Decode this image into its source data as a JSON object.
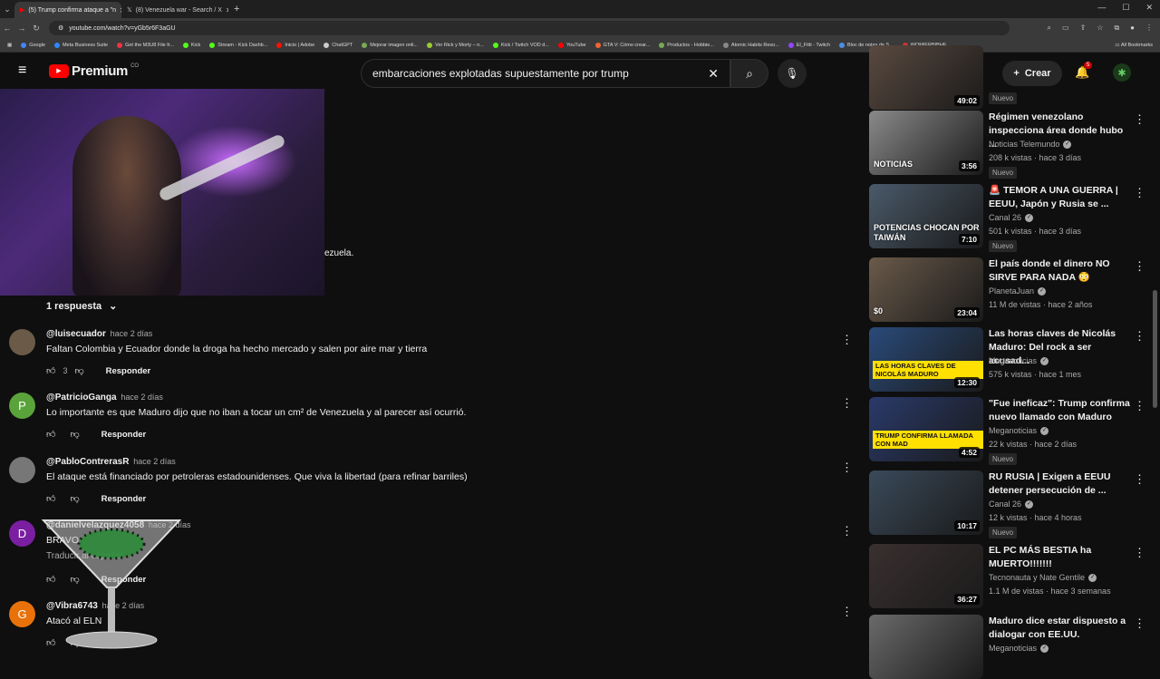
{
  "browser": {
    "tabs": [
      {
        "title": "(5) Trump confirma ataque a \"n",
        "active": true
      },
      {
        "title": "(8) Venezuela war - Search / X",
        "active": false
      }
    ],
    "url": "youtube.com/watch?v=yGb5r6F3aGU",
    "bookmarks": [
      {
        "label": "Google",
        "color": "#4285f4"
      },
      {
        "label": "Meta Business Suite",
        "color": "#2d88ff"
      },
      {
        "label": "Get the M3U8 File fr...",
        "color": "#e34"
      },
      {
        "label": "Kick",
        "color": "#53fc18"
      },
      {
        "label": "Stream - Kick Dashb...",
        "color": "#53fc18"
      },
      {
        "label": "Inicio | Adobe",
        "color": "#fa0f00"
      },
      {
        "label": "ChatGPT",
        "color": "#ccc"
      },
      {
        "label": "Mejorar imagen onli...",
        "color": "#7a5"
      },
      {
        "label": "Ver Rick y Morty – n...",
        "color": "#9c3"
      },
      {
        "label": "Kick / Twitch VOD d...",
        "color": "#53fc18"
      },
      {
        "label": "YouTube",
        "color": "#ff0000"
      },
      {
        "label": "GTA V: Cómo crear...",
        "color": "#e63"
      },
      {
        "label": "Productos - Hobbie...",
        "color": "#7a5"
      },
      {
        "label": "Atomic Habits Reso...",
        "color": "#888"
      },
      {
        "label": "El_Fitti - Twitch",
        "color": "#9146ff"
      },
      {
        "label": "Bloc de notas de S...",
        "color": "#4a90e2"
      },
      {
        "label": "WOMIERBIBHE",
        "color": "#c33"
      }
    ],
    "all_bookmarks": "All Bookmarks"
  },
  "header": {
    "logo_word": "Premium",
    "country": "CO",
    "search_value": "embarcaciones explotadas supuestamente por trump",
    "create_label": "Crear",
    "notif_count": "5"
  },
  "video": {
    "partial_text": "ezuela."
  },
  "replies_label": "1 respuesta",
  "comments": [
    {
      "user": "@luisecuador",
      "time": "hace 2 días",
      "text": "Faltan Colombia y Ecuador donde la droga ha hecho mercado y salen por aire mar y tierra",
      "likes": "3",
      "reply": "Responder",
      "avatar_letter": "",
      "avatar_color": "#6b5a48"
    },
    {
      "user": "@PatricioGanga",
      "time": "hace 2 días",
      "text": "Lo importante es que Maduro dijo que no iban a tocar un cm²  de Venezuela y al parecer así ocurrió.",
      "likes": "",
      "reply": "Responder",
      "avatar_letter": "P",
      "avatar_color": "#5aa33a"
    },
    {
      "user": "@PabloContrerasR",
      "time": "hace 2 días",
      "text": "El ataque está financiado por petroleras estadounidenses. Que viva la libertad (para refinar barriles)",
      "likes": "",
      "reply": "Responder",
      "avatar_letter": "",
      "avatar_color": "#777"
    },
    {
      "user": "@danielvelazquez4058",
      "time": "hace 2 días",
      "text": "BRAVO",
      "translate": "Traducir al español",
      "likes": "",
      "reply": "Responder",
      "avatar_letter": "D",
      "avatar_color": "#7b1fa2"
    },
    {
      "user": "@Vibra6743",
      "time": "hace 2 días",
      "text": "Atacó al ELN",
      "likes": "",
      "reply": "Responder",
      "avatar_letter": "G",
      "avatar_color": "#e8710a"
    }
  ],
  "recommendations": [
    {
      "title": "",
      "channel": "",
      "meta": "",
      "badge": "Nuevo",
      "duration": "49:02",
      "thumb_color": "#5a4a40",
      "caption": ""
    },
    {
      "title": "Régimen venezolano inspecciona área donde hubo ...",
      "channel": "Noticias Telemundo",
      "meta": "208 k vistas · hace 3 días",
      "badge": "Nuevo",
      "duration": "3:56",
      "thumb_color": "#8a8a8a",
      "caption": "NOTICIAS"
    },
    {
      "title": "🚨 TEMOR A UNA GUERRA | EEUU, Japón y Rusia se ...",
      "channel": "Canal 26",
      "meta": "501 k vistas · hace 3 días",
      "badge": "Nuevo",
      "duration": "7:10",
      "thumb_color": "#4a5a6a",
      "caption": "POTENCIAS CHOCAN POR TAIWÁN"
    },
    {
      "title": "El país donde el dinero NO SIRVE PARA NADA 😳",
      "channel": "PlanetaJuan",
      "meta": "11 M de vistas · hace 2 años",
      "badge": "",
      "duration": "23:04",
      "thumb_color": "#6a5a4a",
      "caption": "$0"
    },
    {
      "title": "Las horas claves de Nicolás Maduro: Del rock a ser acusad...",
      "channel": "Meganoticias",
      "meta": "575 k vistas · hace 1 mes",
      "badge": "",
      "duration": "12:30",
      "thumb_color": "#2a4a7a",
      "caption": "LAS HORAS CLAVES DE NICOLÁS MADURO"
    },
    {
      "title": "\"Fue ineficaz\": Trump confirma nuevo llamado con Maduro",
      "channel": "Meganoticias",
      "meta": "22 k vistas · hace 2 días",
      "badge": "Nuevo",
      "duration": "4:52",
      "thumb_color": "#2a3a6a",
      "caption": "TRUMP CONFIRMA LLAMADA CON MAD"
    },
    {
      "title": "RU RUSIA | Exigen a EEUU detener persecución de ...",
      "channel": "Canal 26",
      "meta": "12 k vistas · hace 4 horas",
      "badge": "Nuevo",
      "duration": "10:17",
      "thumb_color": "#3a4a5a",
      "caption": ""
    },
    {
      "title": "EL PC MÁS BESTIA ha MUERTO!!!!!!!",
      "channel": "Tecnonauta y Nate Gentile",
      "meta": "1.1 M de vistas · hace 3 semanas",
      "badge": "",
      "duration": "36:27",
      "thumb_color": "#3a3030",
      "caption": ""
    },
    {
      "title": "Maduro dice estar dispuesto a dialogar con EE.UU.",
      "channel": "Meganoticias",
      "meta": "",
      "badge": "",
      "duration": "",
      "thumb_color": "#6a6a6a",
      "caption": ""
    }
  ]
}
